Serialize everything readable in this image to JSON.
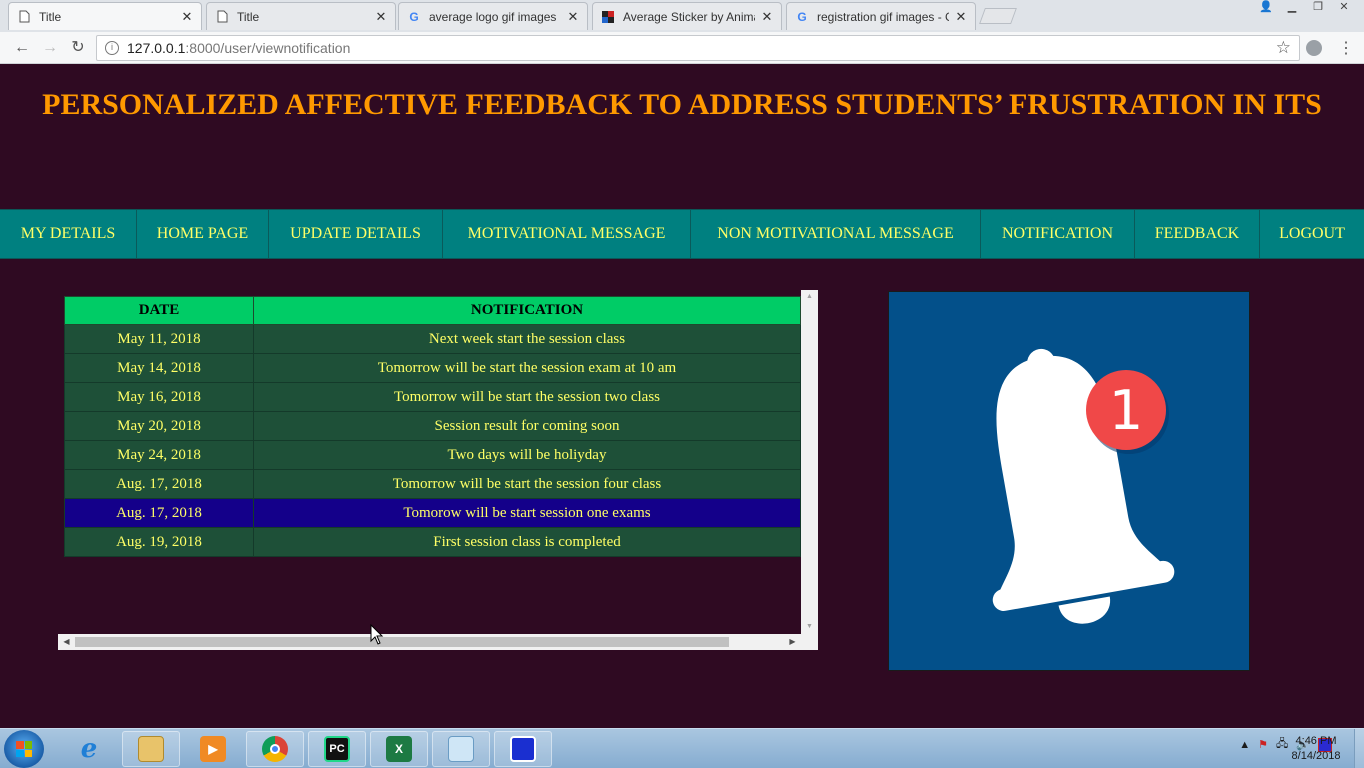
{
  "browser": {
    "tabs": [
      {
        "title": "Title",
        "icon": "page-icon",
        "active": true
      },
      {
        "title": "Title",
        "icon": "page-icon",
        "active": false
      },
      {
        "title": "average logo gif images",
        "icon": "google-icon",
        "active": false
      },
      {
        "title": "Average Sticker by Anima",
        "icon": "sticker-icon",
        "active": false
      },
      {
        "title": "registration gif images - G",
        "icon": "google-icon",
        "active": false
      }
    ],
    "url_host": "127.0.0.1",
    "url_path": ":8000/user/viewnotification"
  },
  "page": {
    "title": "PERSONALIZED AFFECTIVE FEEDBACK TO ADDRESS STUDENTS’ FRUSTRATION IN ITS",
    "nav": [
      {
        "label": "MY DETAILS"
      },
      {
        "label": "HOME PAGE"
      },
      {
        "label": "UPDATE DETAILS"
      },
      {
        "label": "MOTIVATIONAL MESSAGE"
      },
      {
        "label": "NON MOTIVATIONAL MESSAGE"
      },
      {
        "label": "NOTIFICATION"
      },
      {
        "label": "FEEDBACK"
      },
      {
        "label": "LOGOUT"
      }
    ],
    "table": {
      "headers": {
        "date": "DATE",
        "notification": "NOTIFICATION"
      },
      "rows": [
        {
          "date": "May 11, 2018",
          "notification": "Next week start the session class"
        },
        {
          "date": "May 14, 2018",
          "notification": "Tomorrow will be start the session exam at 10 am"
        },
        {
          "date": "May 16, 2018",
          "notification": "Tomorrow will be start the session two class"
        },
        {
          "date": "May 20, 2018",
          "notification": "Session result for coming soon"
        },
        {
          "date": "May 24, 2018",
          "notification": "Two days will be holiyday"
        },
        {
          "date": "Aug. 17, 2018",
          "notification": "Tomorrow will be start the session four class"
        },
        {
          "date": "Aug. 17, 2018",
          "notification": "Tomorow will be start session one exams"
        },
        {
          "date": "Aug. 19, 2018",
          "notification": "First session class is completed"
        }
      ]
    },
    "bell_badge": "1"
  },
  "taskbar": {
    "time": "4:46 PM",
    "date": "8/14/2018"
  },
  "colors": {
    "page_bg": "#2f0a22",
    "title": "#ff9900",
    "nav_bg": "#008080",
    "nav_text": "#ffff66",
    "header_bg": "#00cc66",
    "row_bg": "#1e5038",
    "row_highlight": "#14008a",
    "bell_bg": "#03508a",
    "badge": "#f04848"
  }
}
